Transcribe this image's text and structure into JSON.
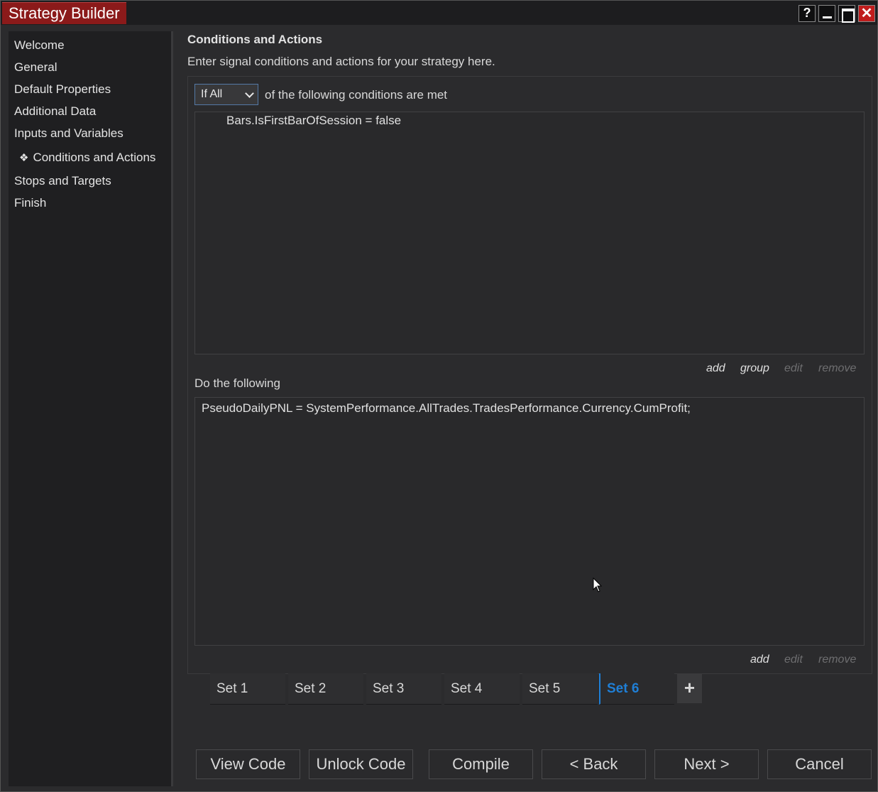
{
  "window": {
    "title": "Strategy Builder",
    "help_label": "?",
    "close_label": "✕"
  },
  "sidebar": {
    "items": [
      {
        "label": "Welcome"
      },
      {
        "label": "General"
      },
      {
        "label": "Default Properties"
      },
      {
        "label": "Additional Data"
      },
      {
        "label": "Inputs and Variables"
      },
      {
        "label": "Conditions and Actions",
        "active": true
      },
      {
        "label": "Stops and Targets"
      },
      {
        "label": "Finish"
      }
    ],
    "active_marker": "❖"
  },
  "main": {
    "title": "Conditions and Actions",
    "subtitle": "Enter signal conditions and actions for your strategy here.",
    "condition_select": {
      "value": "If All"
    },
    "condition_suffix": "of the following conditions are met",
    "conditions": [
      "Bars.IsFirstBarOfSession = false"
    ],
    "condition_actions": {
      "add": "add",
      "group": "group",
      "edit": "edit",
      "remove": "remove"
    },
    "actions_label": "Do the following",
    "actions": [
      "PseudoDailyPNL = SystemPerformance.AllTrades.TradesPerformance.Currency.CumProfit;"
    ],
    "action_actions": {
      "add": "add",
      "edit": "edit",
      "remove": "remove"
    }
  },
  "tabs": {
    "items": [
      "Set 1",
      "Set 2",
      "Set 3",
      "Set 4",
      "Set 5",
      "Set 6"
    ],
    "active_index": 5,
    "add_label": "+"
  },
  "footer": {
    "view_code": "View Code",
    "unlock_code": "Unlock Code",
    "compile": "Compile",
    "back": "< Back",
    "next": "Next >",
    "cancel": "Cancel"
  },
  "colors": {
    "accent": "#1f7fd6",
    "title_tab": "#8b1a1a",
    "close_button": "#c01d1d"
  }
}
